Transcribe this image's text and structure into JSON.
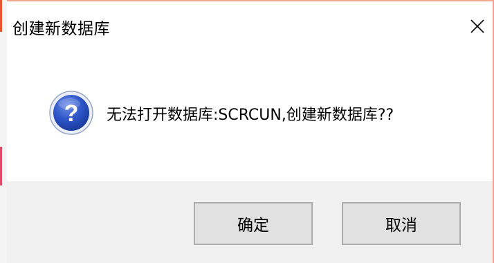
{
  "window": {
    "title": "创建新数据库"
  },
  "message": {
    "text": "无法打开数据库:SCRCUN,创建新数据库??",
    "icon": "question-icon"
  },
  "buttons": {
    "ok_label": "确定",
    "cancel_label": "取消"
  },
  "colors": {
    "button_bar": "#f0f0f0",
    "button_face": "#e1e1e1",
    "button_border": "#adadad",
    "icon_blue": "#2b55c8"
  }
}
